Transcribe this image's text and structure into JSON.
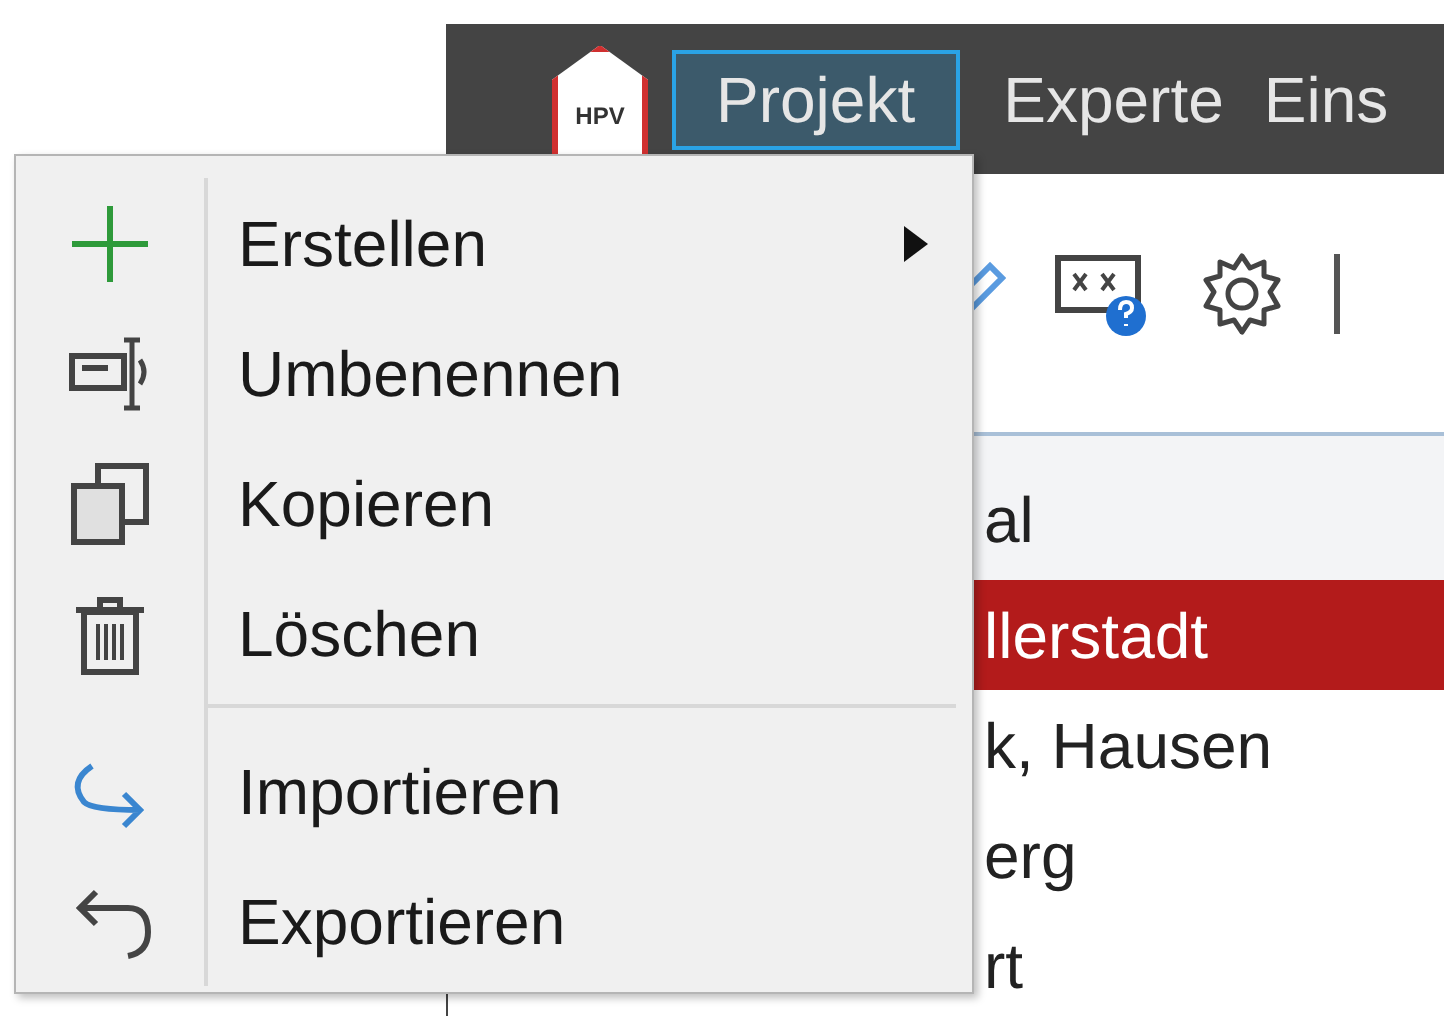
{
  "logo_text": "HPV",
  "menubar": {
    "items": [
      {
        "label": "Projekt",
        "selected": true
      },
      {
        "label": "Experte",
        "selected": false
      },
      {
        "label": "Eins",
        "selected": false
      }
    ]
  },
  "list": {
    "header": "al",
    "rows": [
      {
        "text": "llerstadt",
        "selected": true
      },
      {
        "text": "k, Hausen",
        "selected": false
      },
      {
        "text": "erg",
        "selected": false
      },
      {
        "text": "rt",
        "selected": false
      }
    ]
  },
  "menu": {
    "groups": [
      [
        {
          "label": "Erstellen",
          "kind": "plus",
          "submenu": true
        },
        {
          "label": "Umbenennen",
          "kind": "rename",
          "submenu": false
        },
        {
          "label": "Kopieren",
          "kind": "copy",
          "submenu": false
        },
        {
          "label": "Löschen",
          "kind": "trash",
          "submenu": false
        }
      ],
      [
        {
          "label": "Importieren",
          "kind": "import",
          "submenu": false
        },
        {
          "label": "Exportieren",
          "kind": "export",
          "submenu": false
        }
      ]
    ]
  }
}
